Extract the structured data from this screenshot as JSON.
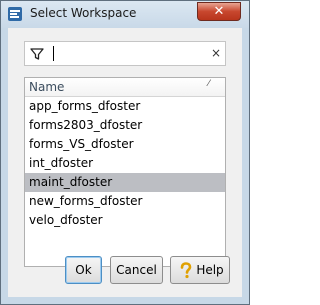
{
  "window": {
    "title": "Select Workspace",
    "close_glyph": "✕"
  },
  "filter": {
    "value": "",
    "placeholder": "",
    "filter_icon": "filter-icon",
    "clear_glyph": "×"
  },
  "list": {
    "column_header": "Name",
    "sort_glyph": "⁄",
    "items": [
      "app_forms_dfoster",
      "forms2803_dfoster",
      "forms_VS_dfoster",
      "int_dfoster",
      "maint_dfoster",
      "new_forms_dfoster",
      "velo_dfoster"
    ],
    "selected": "maint_dfoster"
  },
  "buttons": {
    "ok_label": "Ok",
    "cancel_label": "Cancel",
    "help_label": "Help"
  },
  "colors": {
    "selection": "#bcbec3",
    "close": "#c8472e",
    "default_button_border": "#4d8fc4"
  }
}
